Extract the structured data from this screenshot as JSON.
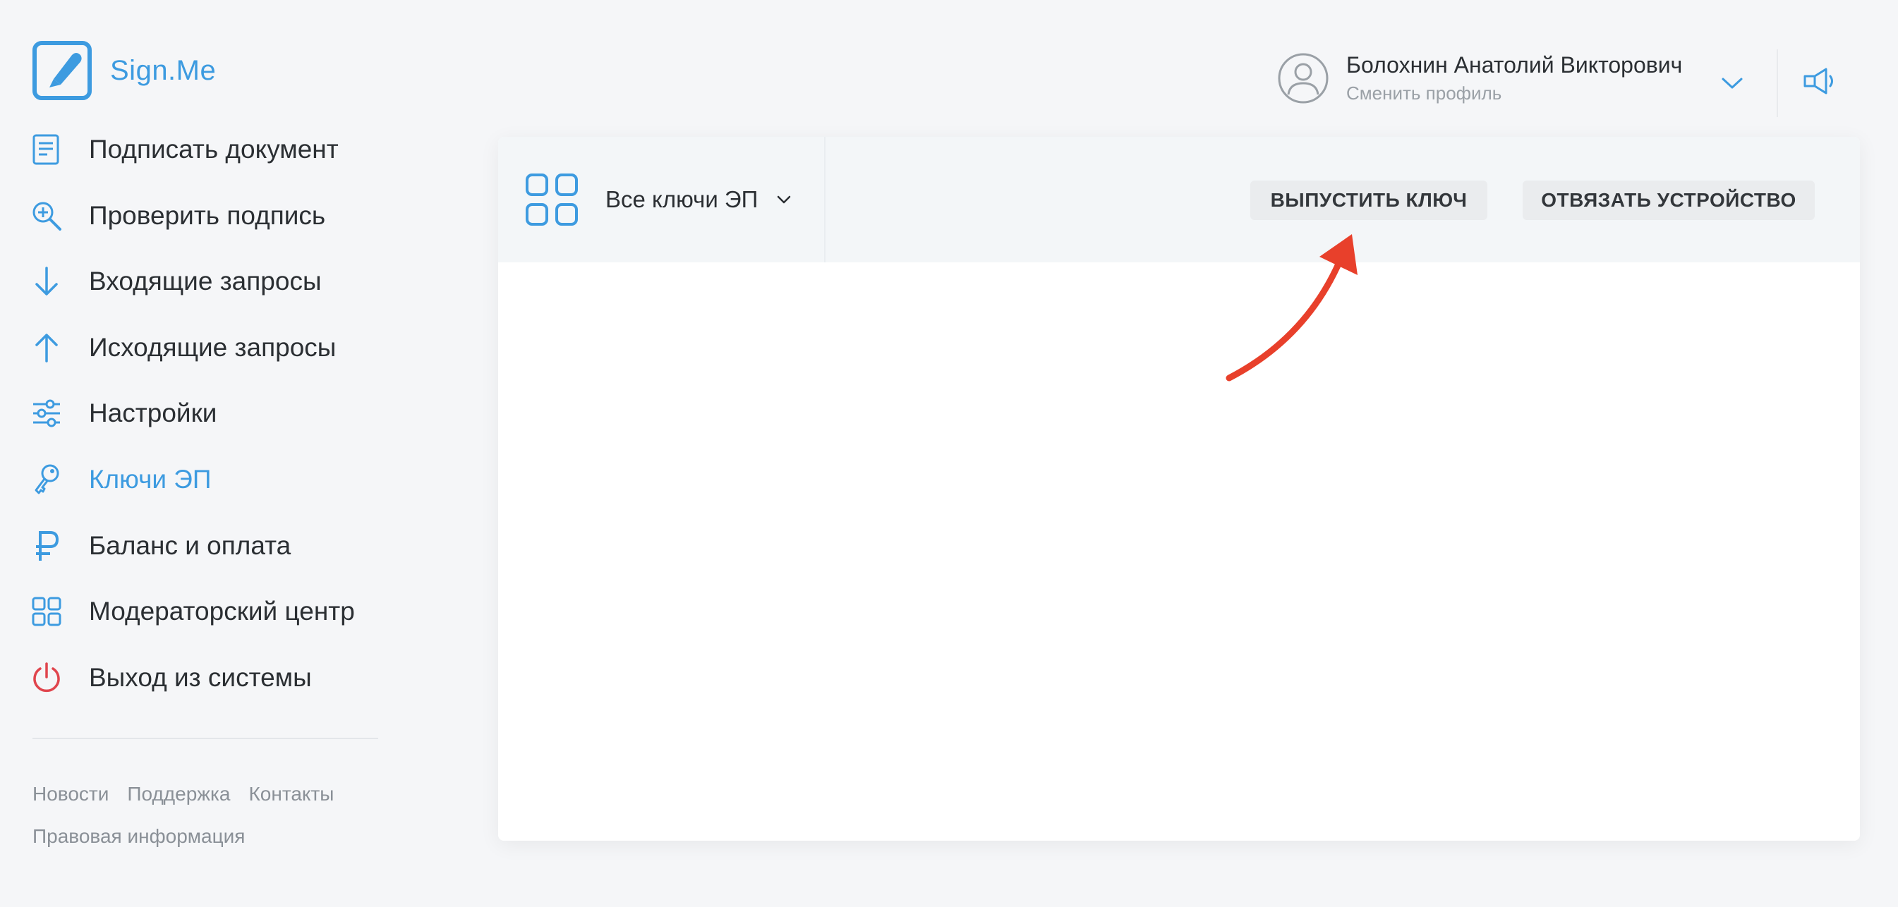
{
  "brand": {
    "name": "Sign.Me"
  },
  "sidebar": {
    "items": [
      {
        "label": "Подписать документ",
        "icon": "document-icon",
        "active": false
      },
      {
        "label": "Проверить подпись",
        "icon": "search-plus-icon",
        "active": false
      },
      {
        "label": "Входящие запросы",
        "icon": "arrow-down-icon",
        "active": false
      },
      {
        "label": "Исходящие запросы",
        "icon": "arrow-up-icon",
        "active": false
      },
      {
        "label": "Настройки",
        "icon": "sliders-icon",
        "active": false
      },
      {
        "label": "Ключи ЭП",
        "icon": "key-icon",
        "active": true
      },
      {
        "label": "Баланс и оплата",
        "icon": "ruble-icon",
        "active": false
      },
      {
        "label": "Модераторский центр",
        "icon": "grid-icon",
        "active": false
      },
      {
        "label": "Выход из системы",
        "icon": "power-icon",
        "active": false
      }
    ],
    "footer": {
      "news": "Новости",
      "support": "Поддержка",
      "contacts": "Контакты",
      "legal": "Правовая информация"
    }
  },
  "header": {
    "user_name": "Болохнин Анатолий Викторович",
    "switch_profile": "Сменить профиль"
  },
  "toolbar": {
    "filter_label": "Все ключи ЭП",
    "issue_key": "ВЫПУСТИТЬ КЛЮЧ",
    "unbind_device": "ОТВЯЗАТЬ УСТРОЙСТВО"
  },
  "colors": {
    "accent": "#3d9be0",
    "danger": "#e0454d",
    "annotation": "#e8402b",
    "background": "#f5f6f8"
  }
}
